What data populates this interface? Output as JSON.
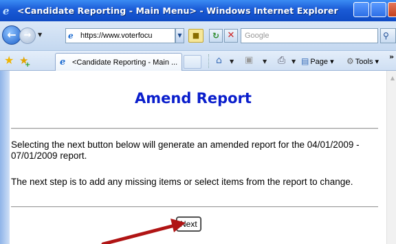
{
  "window": {
    "title": "<Candidate Reporting - Main Menu> - Windows Internet Explorer"
  },
  "addressbar": {
    "url": "https://www.voterfocu",
    "search_placeholder": "Google"
  },
  "tabs": [
    {
      "label": "<Candidate Reporting - Main ..."
    }
  ],
  "commandbar": {
    "page_label": "Page",
    "tools_label": "Tools"
  },
  "page": {
    "heading": "Amend Report",
    "paragraph1": "Selecting the next button below will generate an amended report for the 04/01/2009 - 07/01/2009 report.",
    "paragraph2": "The next step is to add any missing items or select items from the report to change.",
    "next_button_label": "Next"
  },
  "colors": {
    "heading": "#0a1ecc",
    "annotation_arrow": "#b01414"
  }
}
